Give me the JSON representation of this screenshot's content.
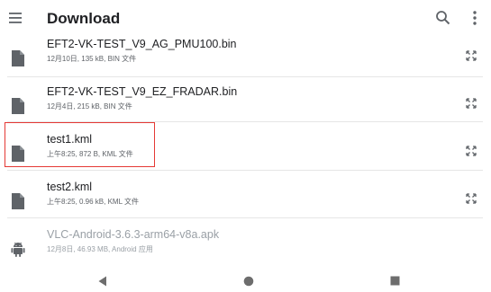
{
  "appbar": {
    "title": "Download",
    "menu_icon": "menu-icon",
    "search_icon": "search-icon",
    "more_icon": "more-vert-icon"
  },
  "files": [
    {
      "name": "EFT2-VK-TEST_V9_AG_PMU100.bin",
      "meta": "12月10日, 135 kB, BIN 文件",
      "icon": "file-icon"
    },
    {
      "name": "EFT2-VK-TEST_V9_EZ_FRADAR.bin",
      "meta": "12月4日, 215 kB, BIN 文件",
      "icon": "file-icon"
    },
    {
      "name": "test1.kml",
      "meta": "上午8:25, 872 B, KML 文件",
      "icon": "file-icon"
    },
    {
      "name": "test2.kml",
      "meta": "上午8:25, 0.96 kB, KML 文件",
      "icon": "file-icon"
    },
    {
      "name": "VLC-Android-3.6.3-arm64-v8a.apk",
      "meta": "12月8日, 46.93 MB, Android 应用",
      "icon": "android-icon"
    }
  ],
  "colors": {
    "highlight": "#e53935",
    "icon": "#5f6368",
    "dim_text": "#9aa0a6"
  },
  "navbar": {
    "back_icon": "back-triangle-icon",
    "home_icon": "home-circle-icon",
    "recents_icon": "recents-square-icon"
  }
}
